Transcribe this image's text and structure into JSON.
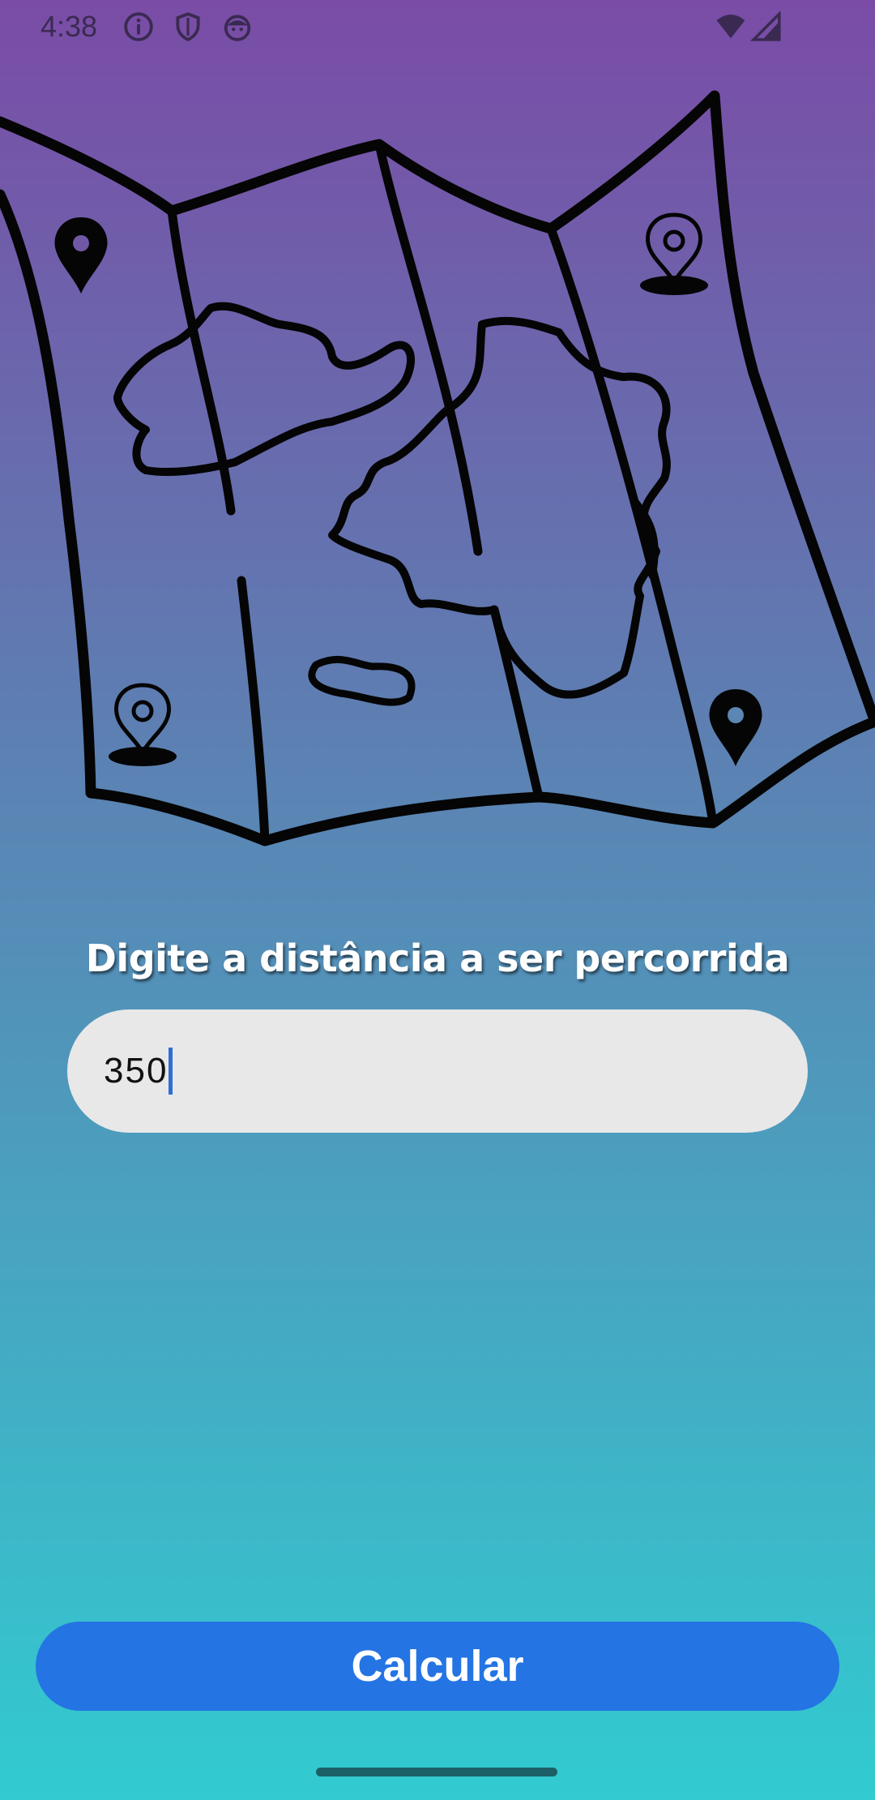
{
  "status_bar": {
    "time": "4:38",
    "left_icons": [
      "info-icon",
      "shield-icon",
      "android-face-icon"
    ],
    "right_icons": [
      "wifi-icon",
      "cell-signal-icon"
    ]
  },
  "illustration": {
    "name": "folded-map-illustration",
    "pins": [
      "map-pin-icon",
      "map-pin-outline-icon",
      "map-pin-outline-icon",
      "map-pin-icon"
    ]
  },
  "form": {
    "prompt": "Digite a distância a ser percorrida",
    "distance_value": "350"
  },
  "actions": {
    "calculate_label": "Calcular"
  },
  "colors": {
    "gradient_top": "#7a4ca6",
    "gradient_bottom": "#31cbd1",
    "button": "#2474e4",
    "input_bg": "#e8e8e8",
    "caret": "#2d6fd6"
  }
}
